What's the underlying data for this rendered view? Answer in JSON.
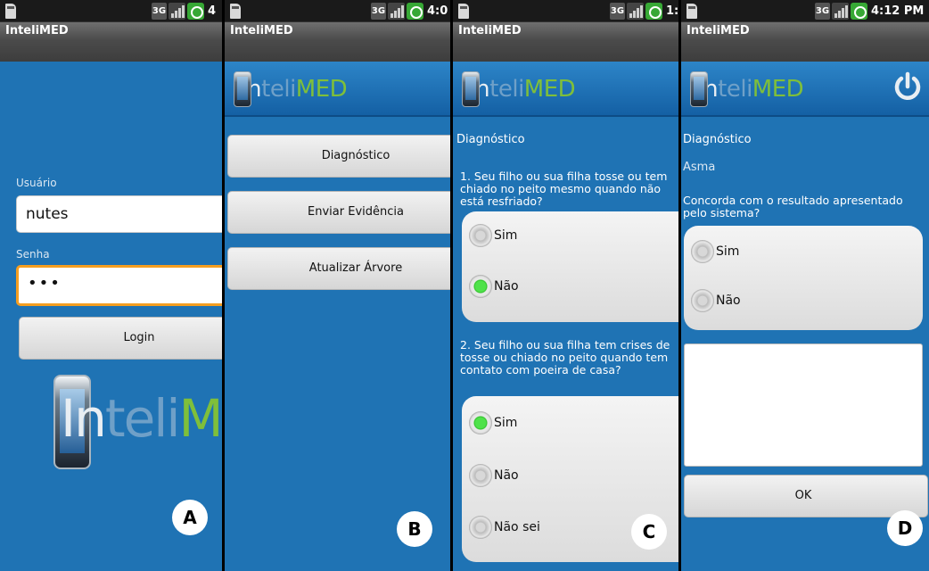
{
  "colors": {
    "accent": "#1f73b4",
    "focus": "#f59e20",
    "radio_checked": "#2cbf26"
  },
  "status_bar": {
    "network": "3G",
    "panel_a_time": "4",
    "panel_b_time": "4:0",
    "panel_c_time": "1:",
    "panel_d_time": "4:12 PM",
    "icons": [
      "sd-card-icon",
      "3g-icon",
      "signal-icon",
      "battery-icon"
    ]
  },
  "app": {
    "title": "InteliMED"
  },
  "logo": {
    "part1": "In",
    "part2": "teli",
    "part3": "MED"
  },
  "screen_a": {
    "username_label": "Usuário",
    "username_value": "nutes",
    "password_label": "Senha",
    "password_value": "•••",
    "login_button": "Login",
    "badge": "A"
  },
  "screen_b": {
    "menu": [
      "Diagnóstico",
      "Enviar Evidência",
      "Atualizar Árvore"
    ],
    "badge": "B"
  },
  "screen_c": {
    "section": "Diagnóstico",
    "q1": "1. Seu filho ou sua filha  tosse ou tem chiado no peito mesmo quando não está resfriado?",
    "q1_options": [
      "Sim",
      "Não"
    ],
    "q1_selected": "Não",
    "q2": "2. Seu filho ou sua filha  tem crises de tosse ou chiado  no peito  quando tem contato com poeira de casa?",
    "q2_options": [
      "Sim",
      "Não",
      "Não sei"
    ],
    "q2_selected": "Sim",
    "badge": "C"
  },
  "screen_d": {
    "section": "Diagnóstico",
    "result": "Asma",
    "question": "Concorda com o resultado apresentado pelo sistema?",
    "options": [
      "Sim",
      "Não"
    ],
    "ok_button": "OK",
    "badge": "D"
  }
}
